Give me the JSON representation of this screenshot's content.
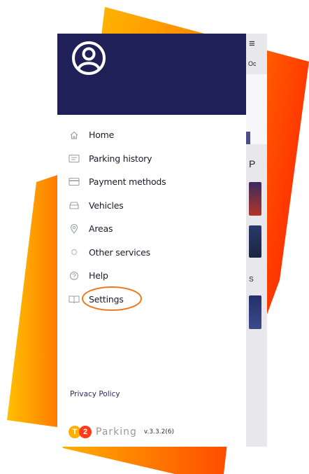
{
  "drawer": {
    "items": [
      {
        "label": "Home",
        "icon": "home-icon"
      },
      {
        "label": "Parking history",
        "icon": "receipt-icon"
      },
      {
        "label": "Payment methods",
        "icon": "credit-card-icon"
      },
      {
        "label": "Vehicles",
        "icon": "car-icon"
      },
      {
        "label": "Areas",
        "icon": "location-pin-icon"
      },
      {
        "label": "Other services",
        "icon": "circle-icon"
      },
      {
        "label": "Help",
        "icon": "help-icon"
      },
      {
        "label": "Settings",
        "icon": "book-icon"
      }
    ],
    "privacy_policy": "Privacy Policy",
    "brand": {
      "logo_letter_1": "T",
      "logo_letter_2": "2",
      "name": "Parking",
      "version": "v.3.3.2(6)"
    }
  },
  "background_screen": {
    "menu_glyph": "≡",
    "text_1": "Oc",
    "text_2": "P",
    "text_3": "S"
  },
  "colors": {
    "header": "#1e2057",
    "accent_orange": "#f07a1a",
    "gradient_yellow": "#ffc400",
    "gradient_red": "#ff3a00"
  }
}
